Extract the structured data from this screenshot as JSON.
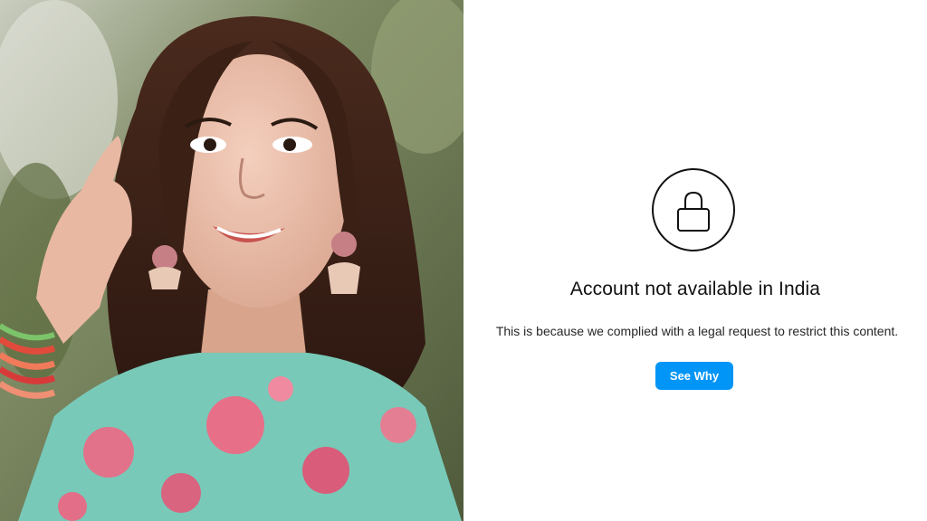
{
  "notice": {
    "lock_icon": "lock-icon",
    "title": "Account not available in India",
    "message": "This is because we complied with a legal request to restrict this content.",
    "button_label": "See Why"
  },
  "colors": {
    "button_bg": "#0095f6",
    "button_text": "#ffffff",
    "title_text": "#111111",
    "body_text": "#262626",
    "icon_stroke": "#111111"
  },
  "photo": {
    "semantic": "profile-photo"
  }
}
